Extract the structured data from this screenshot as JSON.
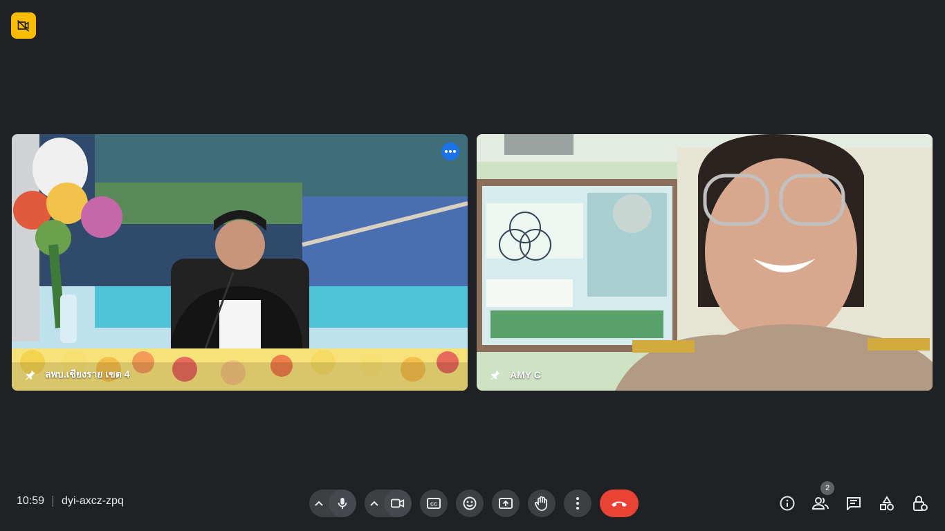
{
  "participants": [
    {
      "name": "ลพบ.เชียงราย เขต 4",
      "pinned": true
    },
    {
      "name": "AMY C",
      "pinned": true
    }
  ],
  "meeting": {
    "time": "10:59",
    "code": "dyi-axcz-zpq"
  },
  "people_count": "2",
  "icons": {
    "camera_off_badge": "no-camera-icon",
    "pin": "pin-icon",
    "more": "more-options-icon",
    "mic": "mic-icon",
    "camera": "camera-icon",
    "captions": "captions-icon",
    "reactions": "emoji-icon",
    "present": "present-screen-icon",
    "raise_hand": "hand-icon",
    "more_options": "vertical-dots-icon",
    "end_call": "end-call-icon",
    "info": "info-icon",
    "people": "people-icon",
    "chat": "chat-icon",
    "activities": "activities-icon",
    "host_controls": "lock-icon"
  },
  "colors": {
    "background": "#202124",
    "end_call": "#ea4335",
    "camera_off_badge": "#fbbc04",
    "accent": "#1a73e8"
  }
}
